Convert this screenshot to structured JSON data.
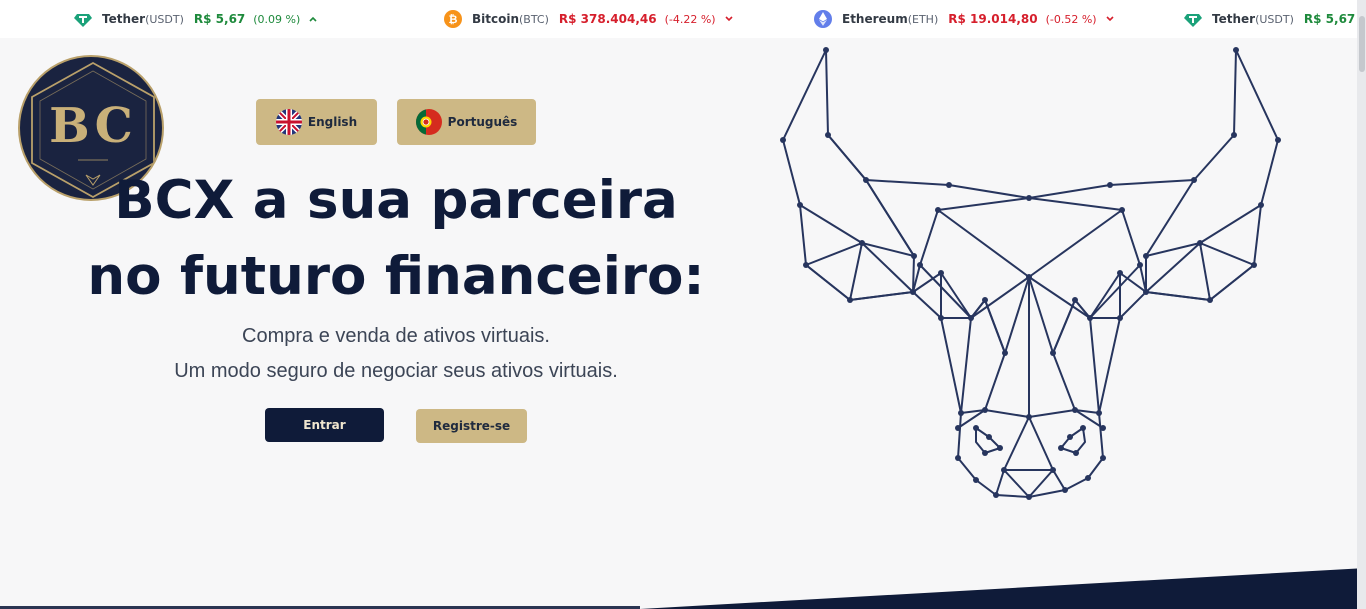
{
  "ticker": [
    {
      "name": "Tether",
      "symbol": "(USDT)",
      "price": "R$ 5,67",
      "change": "(0.09 %)",
      "direction": "up",
      "icon": "tether-icon",
      "color": "#1ba27a"
    },
    {
      "name": "Bitcoin",
      "symbol": "(BTC)",
      "price": "R$ 378.404,46",
      "change": "(-4.22 %)",
      "direction": "down",
      "icon": "bitcoin-icon",
      "color": "#f7931a"
    },
    {
      "name": "Ethereum",
      "symbol": "(ETH)",
      "price": "R$ 19.014,80",
      "change": "(-0.52 %)",
      "direction": "down",
      "icon": "ethereum-icon",
      "color": "#627eea"
    },
    {
      "name": "Tether",
      "symbol": "(USDT)",
      "price": "R$ 5,67",
      "change": "",
      "direction": "up",
      "icon": "tether-icon",
      "color": "#1ba27a"
    }
  ],
  "logo": {
    "text": "BC"
  },
  "languages": [
    {
      "label": "English",
      "icon": "uk-flag-icon"
    },
    {
      "label": "Português",
      "icon": "portugal-flag-icon"
    }
  ],
  "hero": {
    "title_line1": "BCX a sua parceira",
    "title_line2": "no futuro financeiro:",
    "subtitle_line1": "Compra e venda de ativos virtuais.",
    "subtitle_line2": "Um modo seguro de negociar seus ativos virtuais.",
    "login_label": "Entrar",
    "register_label": "Registre-se"
  },
  "colors": {
    "navy": "#0f1b39",
    "gold": "#cdb885",
    "up": "#1e8a3c",
    "down": "#d61f2c"
  }
}
